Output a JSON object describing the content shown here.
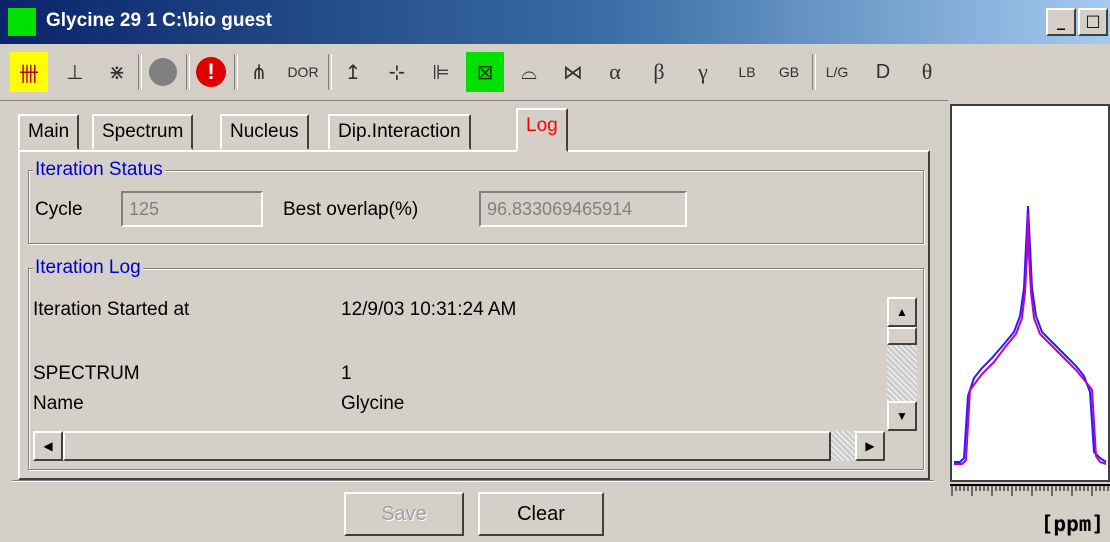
{
  "window": {
    "title": "Glycine 29 1 C:\\bio guest",
    "controls": {
      "minimize": "_",
      "maximize": "□",
      "close": "✕"
    }
  },
  "toolbar": {
    "items": [
      {
        "id": "spectrum-fit",
        "glyph": "卌"
      },
      {
        "id": "peak-left",
        "glyph": "⊥"
      },
      {
        "id": "peak-cross",
        "glyph": "⋇"
      },
      {
        "id": "stop",
        "glyph": ""
      },
      {
        "id": "alert",
        "glyph": "!"
      },
      {
        "id": "multiplet",
        "glyph": "⋔"
      },
      {
        "id": "dor",
        "glyph": "DOR"
      },
      {
        "id": "axis-up",
        "glyph": "↥"
      },
      {
        "id": "axis-split",
        "glyph": "⊹"
      },
      {
        "id": "axis-grid",
        "glyph": "⊫"
      },
      {
        "id": "fit-active",
        "glyph": "⊠"
      },
      {
        "id": "spinning",
        "glyph": "⌓"
      },
      {
        "id": "doublet",
        "glyph": "⋈"
      },
      {
        "id": "alpha",
        "glyph": "α"
      },
      {
        "id": "beta",
        "glyph": "β"
      },
      {
        "id": "gamma",
        "glyph": "γ"
      },
      {
        "id": "lb",
        "glyph": "LB"
      },
      {
        "id": "gb",
        "glyph": "GB"
      },
      {
        "id": "lg",
        "glyph": "L/G"
      },
      {
        "id": "d",
        "glyph": "D"
      },
      {
        "id": "theta",
        "glyph": "θ"
      }
    ]
  },
  "tabs": [
    "Main",
    "Spectrum",
    "Nucleus",
    "Dip.Interaction",
    "Log"
  ],
  "active_tab": "Log",
  "iteration_status": {
    "legend": "Iteration Status",
    "cycle_label": "Cycle",
    "cycle_value": "125",
    "overlap_label": "Best overlap(%)",
    "overlap_value": "96.833069465914"
  },
  "iteration_log": {
    "legend": "Iteration Log",
    "lines": [
      {
        "key": "Iteration Started at",
        "value": "12/9/03 10:31:24 AM"
      },
      {
        "key": "",
        "value": ""
      },
      {
        "key": "SPECTRUM",
        "value": "1"
      },
      {
        "key": "Name",
        "value": "Glycine"
      }
    ]
  },
  "buttons": {
    "save": "Save",
    "clear": "Clear"
  },
  "spectrum_panel": {
    "unit_label": "[ppm]",
    "experimental_color": "#2020ff",
    "fit_color": "#c000c0"
  },
  "colors": {
    "title_bar": "#0a246a",
    "legend_text": "#0000d0",
    "active_tab_text": "#ff0000"
  }
}
